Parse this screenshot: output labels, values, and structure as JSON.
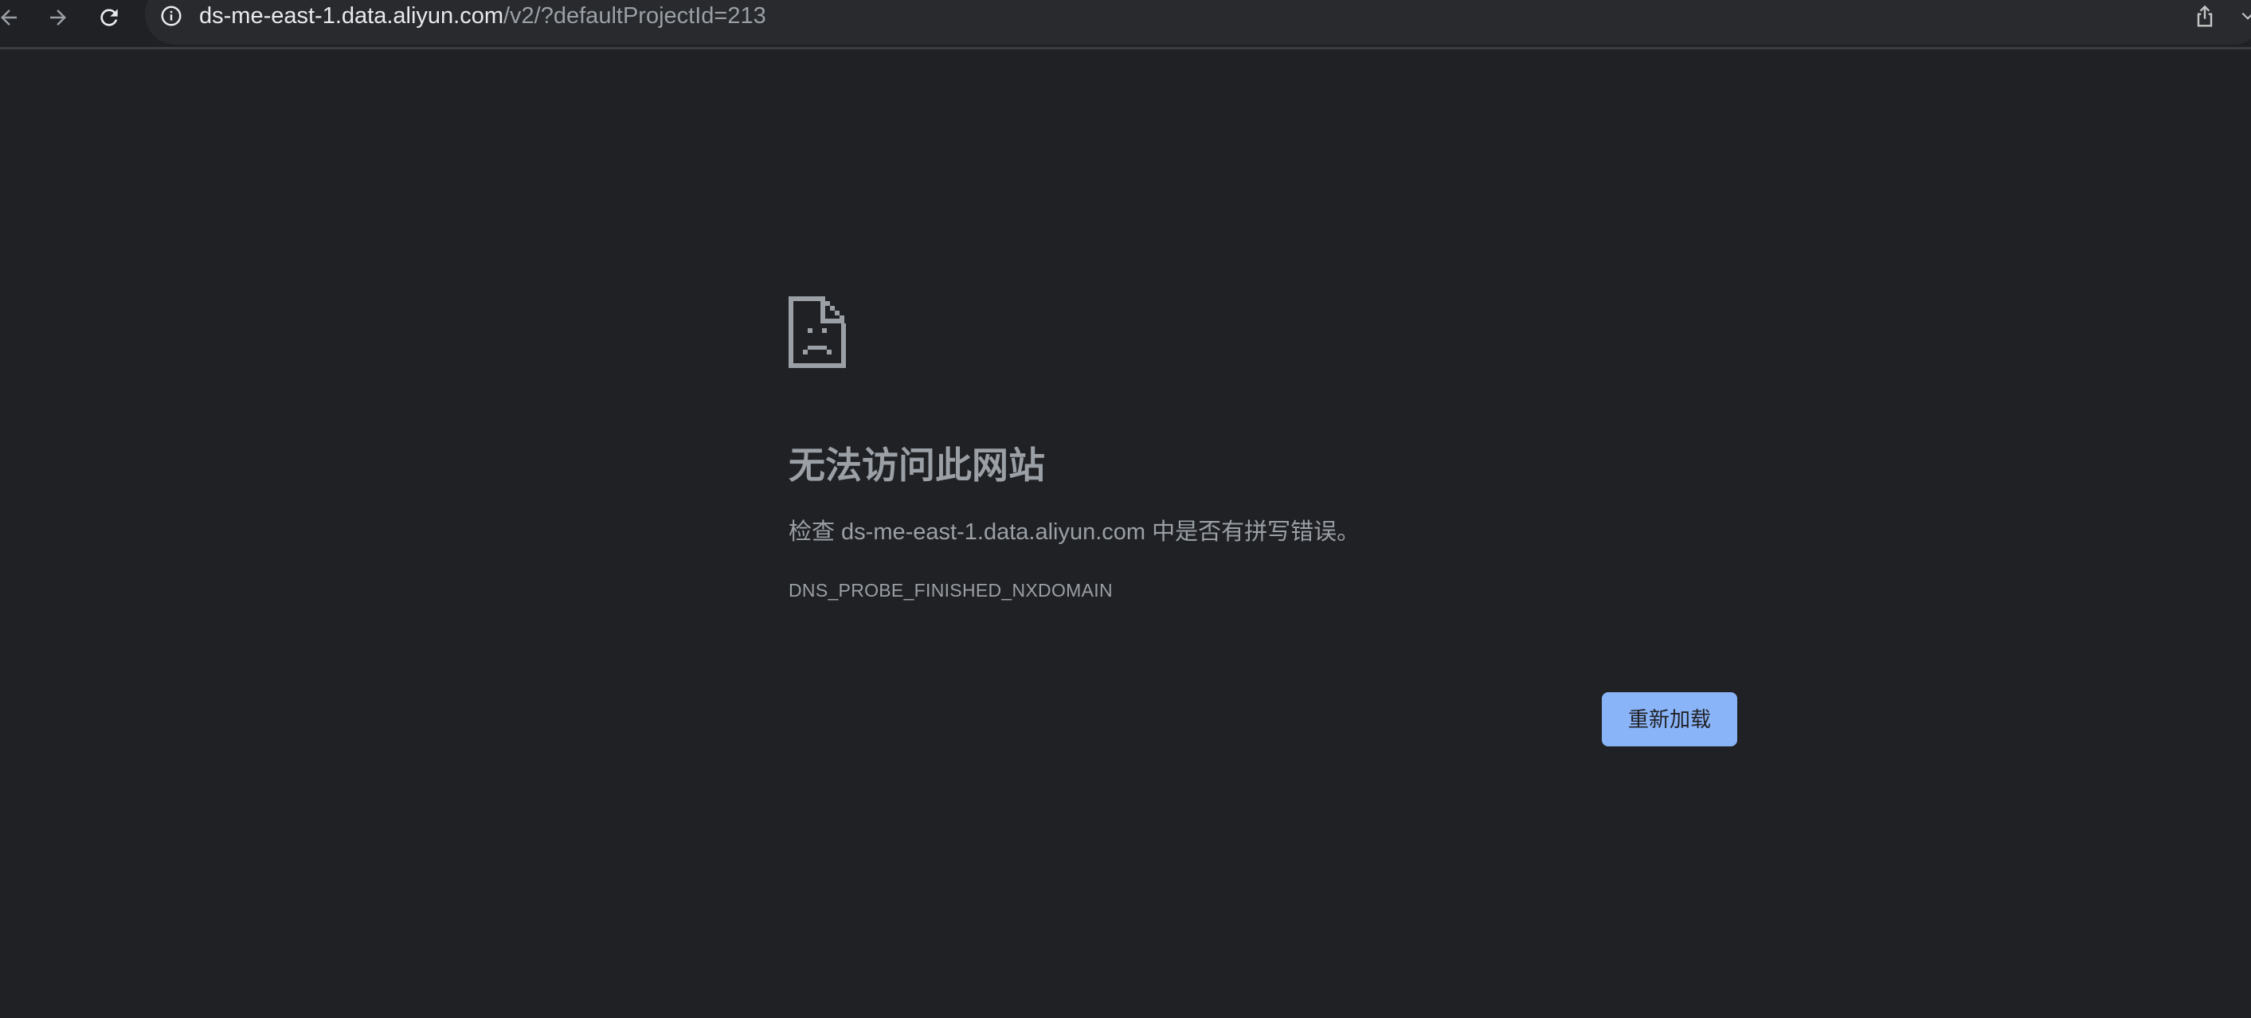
{
  "browser": {
    "url_host": "ds-me-east-1.data.aliyun.com",
    "url_path": "/v2/?defaultProjectId=213",
    "icons": {
      "back": "arrow-left-icon",
      "forward": "arrow-right-icon",
      "reload": "reload-icon",
      "site_info": "info-icon",
      "share": "share-icon",
      "menu": "chevron-down-icon"
    }
  },
  "error_page": {
    "icon": "sad-document-icon",
    "title": "无法访问此网站",
    "description": "检查 ds-me-east-1.data.aliyun.com 中是否有拼写错误。",
    "error_code": "DNS_PROBE_FINISHED_NXDOMAIN",
    "reload_button": "重新加载"
  },
  "colors": {
    "background": "#202124",
    "text": "#9aa0a6",
    "button": "#8ab4f8"
  }
}
